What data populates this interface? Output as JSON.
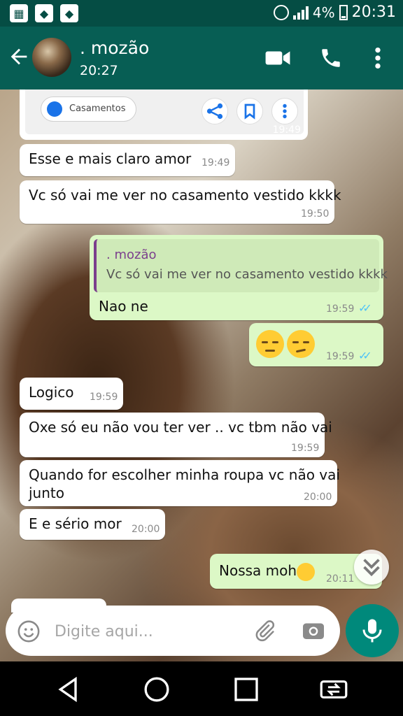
{
  "status_bar": {
    "battery": "4%",
    "time": "20:31",
    "icons": [
      "notification-icon",
      "notification-icon",
      "notification-icon",
      "alarm-icon",
      "signal-icon",
      "battery-icon"
    ]
  },
  "header": {
    "contact_name": ". mozão",
    "last_seen": "20:27",
    "icons": [
      "back-arrow-icon",
      "video-call-icon",
      "phone-icon",
      "more-vert-icon"
    ]
  },
  "link_card": {
    "chip_label": "Casamentos",
    "time": "19:49"
  },
  "messages": [
    {
      "dir": "in",
      "text": "Esse e mais claro amor",
      "time": "19:49"
    },
    {
      "dir": "in",
      "text": "Vc só vai me ver no casamento vestido kkkk",
      "time": "19:50"
    },
    {
      "dir": "out",
      "quote_name": ". mozão",
      "quote_text": "Vc só vai me ver no casamento vestido kkkk",
      "text": "Nao ne",
      "time": "19:59",
      "status": "read"
    },
    {
      "dir": "out",
      "text": "",
      "emojis": [
        "pensive-face-emoji",
        "unamused-face-emoji"
      ],
      "time": "19:59",
      "status": "read"
    },
    {
      "dir": "in",
      "text": "Logico",
      "time": "19:59"
    },
    {
      "dir": "in",
      "text": "Oxe só eu não vou ter ver ..  vc tbm não vai",
      "time": "19:59"
    },
    {
      "dir": "in",
      "text_line1": "Quando for escolher minha roupa vc não vai",
      "text_line2": "junto",
      "time": "20:00"
    },
    {
      "dir": "in",
      "text": "E e sério mor",
      "time": "20:00"
    },
    {
      "dir": "out",
      "text": "Nossa moh",
      "emojis": [
        "pensive-face-emoji"
      ],
      "time": "20:11"
    }
  ],
  "composer": {
    "placeholder": "Digite aqui...",
    "icons": [
      "emoji-icon",
      "attach-icon",
      "camera-icon",
      "mic-icon"
    ]
  },
  "colors": {
    "header": "#075e54",
    "status_bar": "#054d44",
    "outgoing_bubble": "#dcf8c6",
    "incoming_bubble": "#ffffff",
    "read_ticks": "#4fc3f7",
    "mic_button": "#00897b"
  }
}
